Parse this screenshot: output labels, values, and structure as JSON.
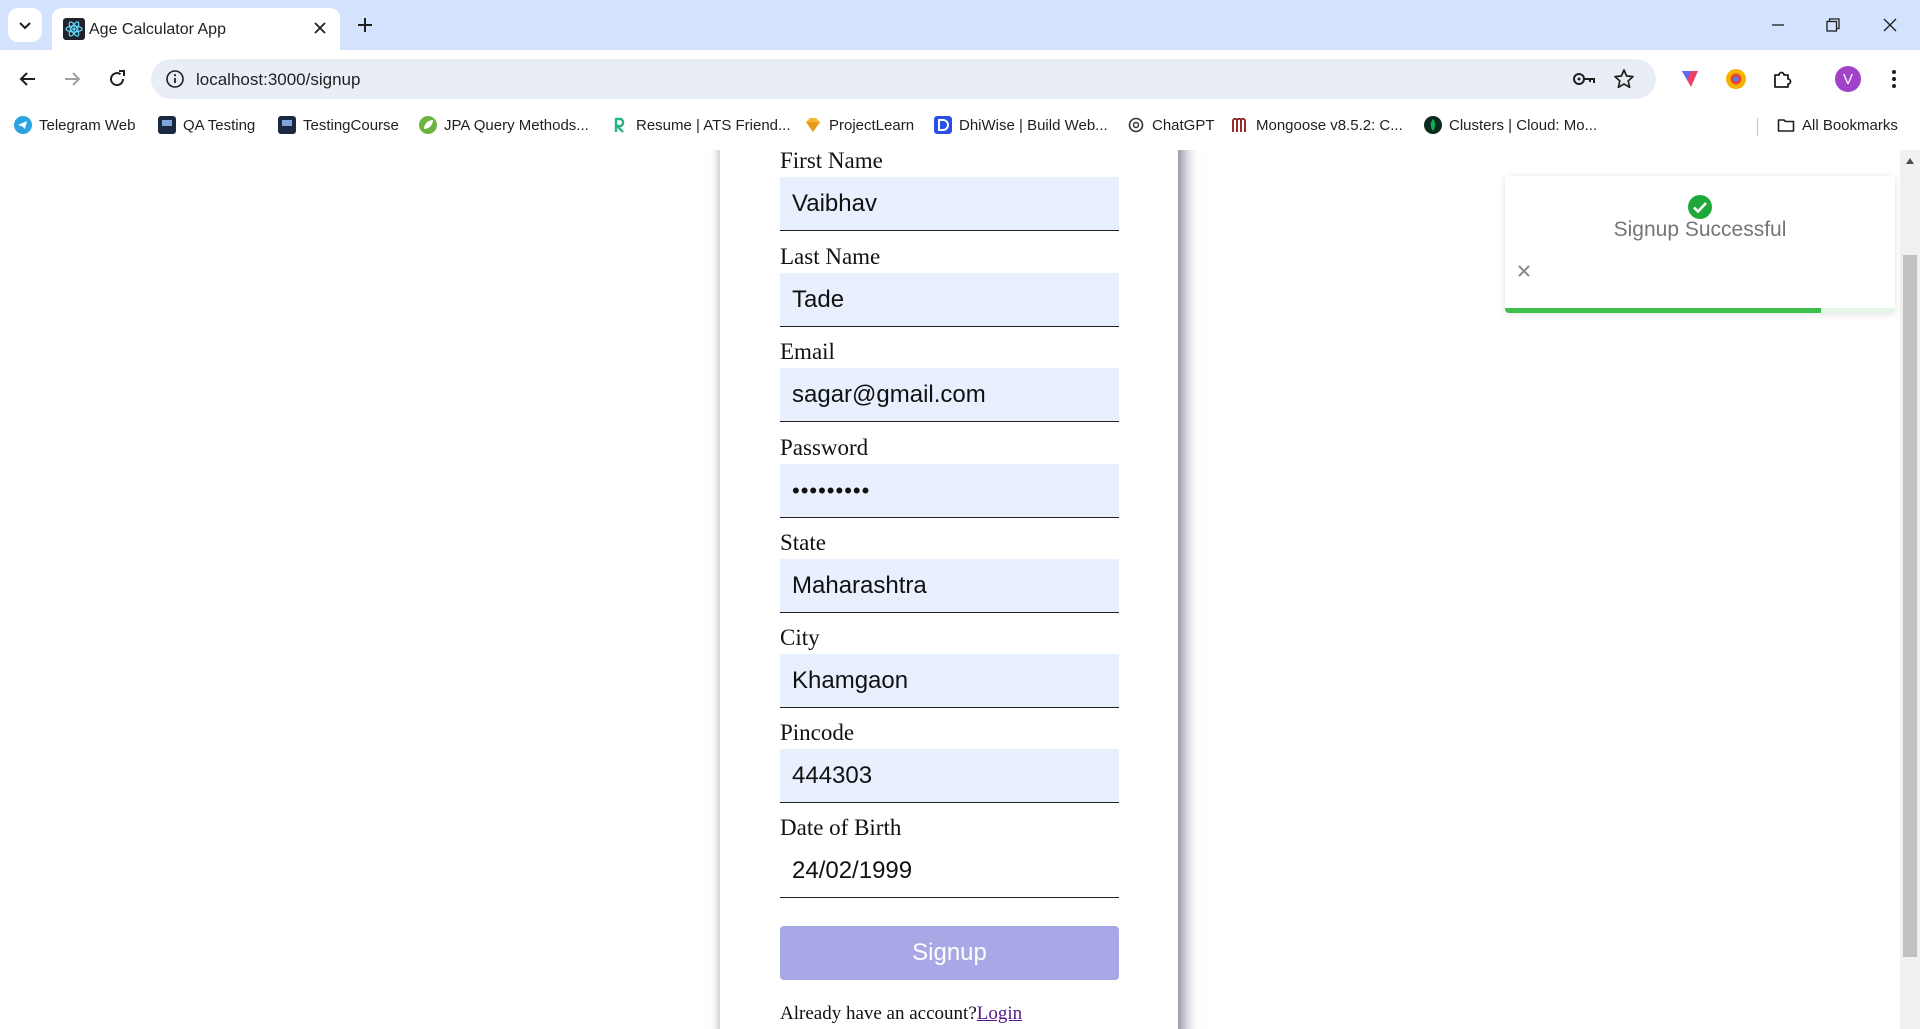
{
  "browser": {
    "tab": {
      "title": "Age Calculator App"
    },
    "omnibox": {
      "url": "localhost:3000/signup"
    },
    "profile_initial": "V",
    "bookmarks": [
      "Telegram Web",
      "QA Testing",
      "TestingCourse",
      "JPA Query Methods...",
      "Resume | ATS Friend...",
      "ProjectLearn",
      "DhiWise | Build Web...",
      "ChatGPT",
      "Mongoose v8.5.2: C...",
      "Clusters | Cloud: Mo..."
    ],
    "all_bookmarks": "All Bookmarks"
  },
  "form": {
    "fields": [
      {
        "label": "First Name",
        "value": "Vaibhav"
      },
      {
        "label": "Last Name",
        "value": "Tade"
      },
      {
        "label": "Email",
        "value": "sagar@gmail.com"
      },
      {
        "label": "Password",
        "value": "•••••••••"
      },
      {
        "label": "State",
        "value": "Maharashtra"
      },
      {
        "label": "City",
        "value": "Khamgaon"
      },
      {
        "label": "Pincode",
        "value": "444303"
      },
      {
        "label": "Date of Birth",
        "value": "24/02/1999"
      }
    ],
    "submit_label": "Signup",
    "have_account_text": "Already have an account?",
    "login_link": "Login"
  },
  "toast": {
    "message": "Signup Successful",
    "progress_fraction": 0.81,
    "color": "#3dc14a"
  }
}
